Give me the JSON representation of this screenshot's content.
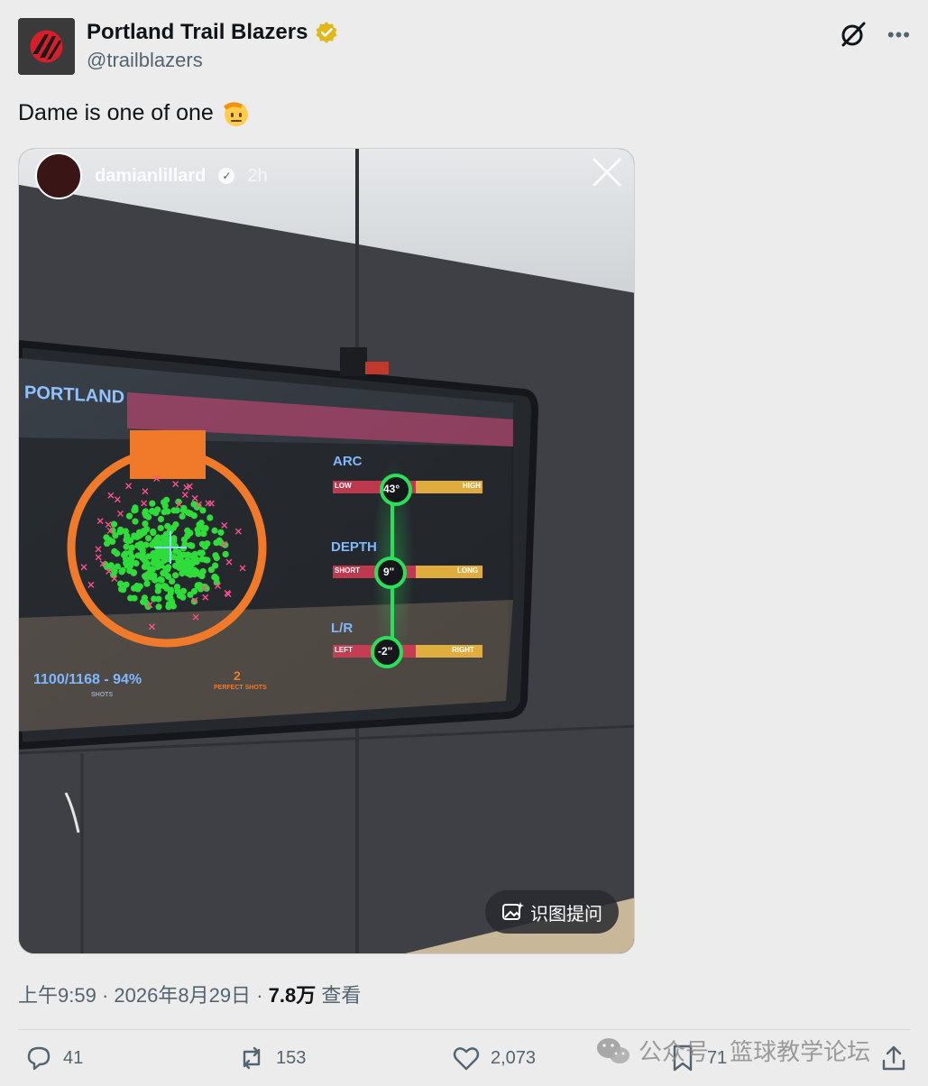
{
  "account": {
    "name": "Portland Trail Blazers",
    "handle": "@trailblazers",
    "verified_color": "#e2b719"
  },
  "tweet": {
    "text": "Dame is one of one",
    "emoji": "saluting-face-emoji"
  },
  "media": {
    "story_username": "damianlillard",
    "story_time": "2h",
    "hud": {
      "brand": "PORTLAND",
      "arc_label": "ARC",
      "arc_low": "LOW",
      "arc_value": "43°",
      "arc_high": "HIGH",
      "depth_label": "DEPTH",
      "depth_short": "SHORT",
      "depth_value": "9\"",
      "depth_long": "LONG",
      "lr_label": "L/R",
      "lr_left": "LEFT",
      "lr_value": "-2\"",
      "lr_right": "RIGHT",
      "shots_summary": "1100/1168 - 94%",
      "shots_caption": "SHOTS",
      "perfect_count": "2",
      "perfect_caption": "PERFECT SHOTS"
    },
    "identify_button": "识图提问"
  },
  "meta": {
    "time": "上午9:59",
    "date": "2026年8月29日",
    "views_count": "7.8万",
    "views_label": "查看",
    "separator": "·"
  },
  "actions": {
    "replies": "41",
    "reposts": "153",
    "likes": "2,073",
    "bookmarks": "71"
  },
  "watermark": {
    "text": "公众号 · 篮球教学论坛"
  },
  "colors": {
    "accent_orange": "#f07a2a",
    "made_shot_green": "#2edc3a",
    "missed_shot_pink": "#ff4f8b",
    "hud_green": "#29e05a"
  }
}
